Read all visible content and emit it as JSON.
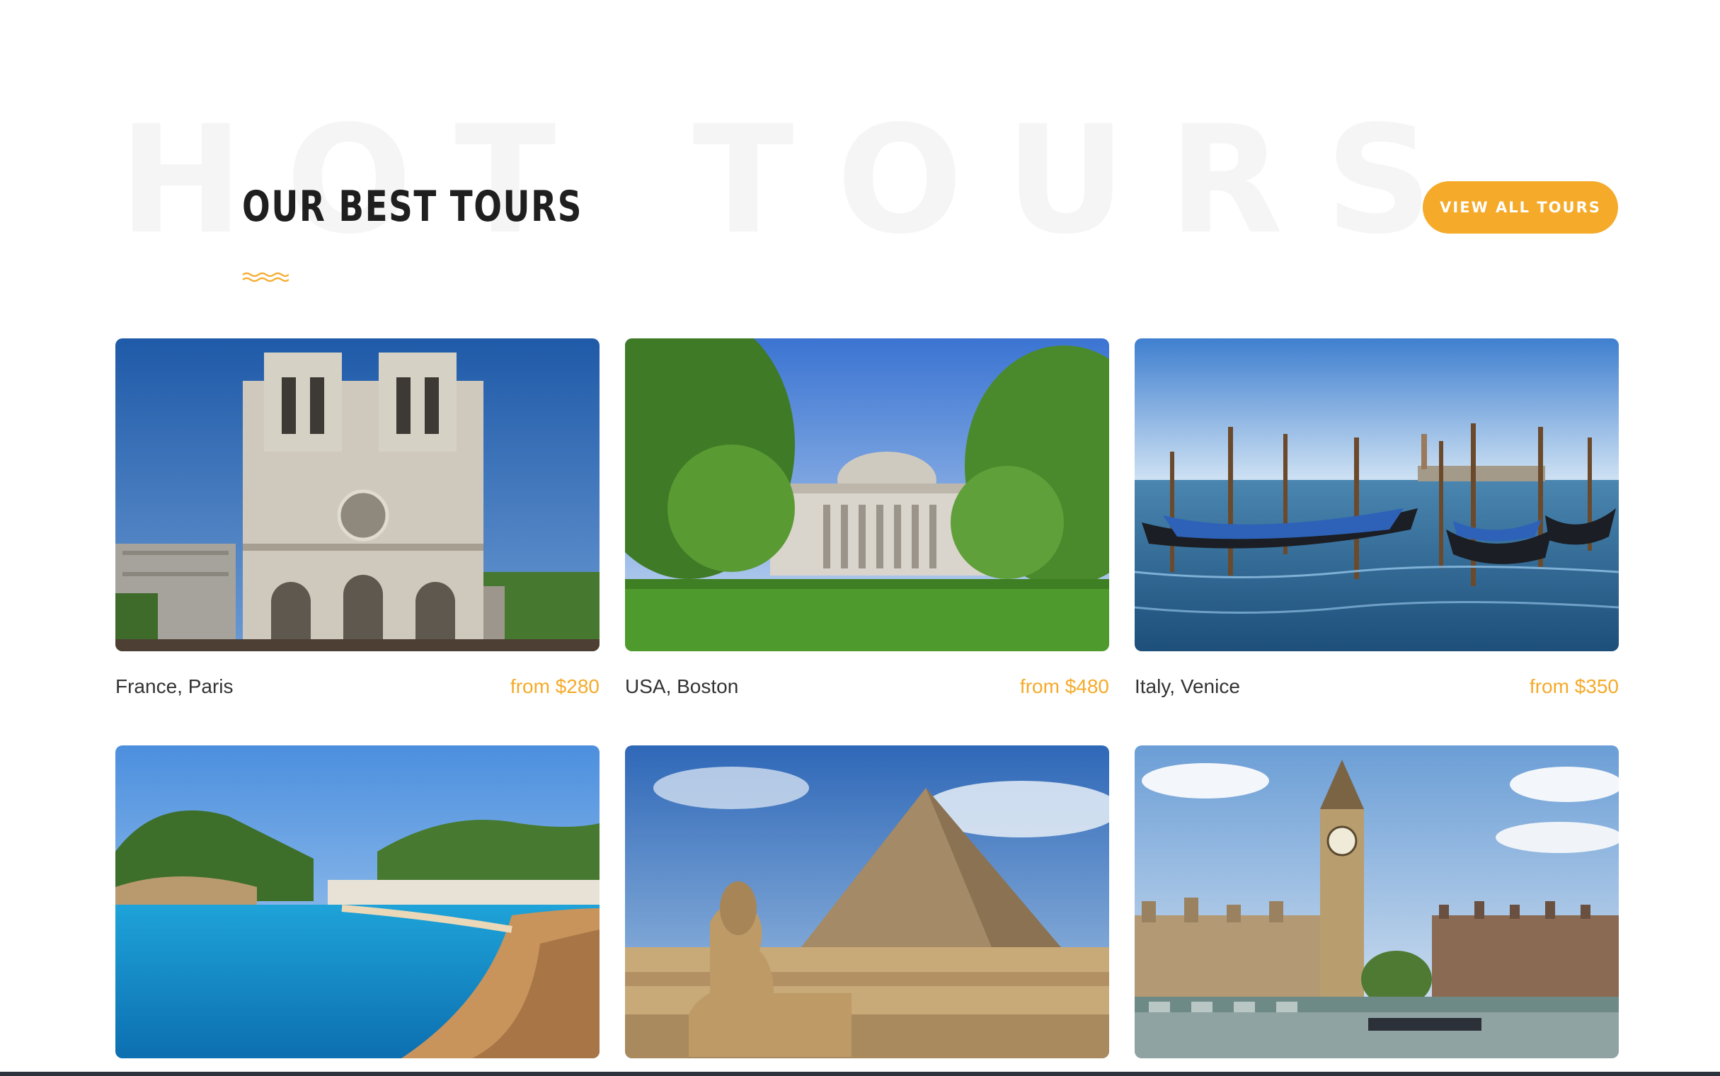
{
  "background_word": "HOT TOURS",
  "section": {
    "title": "OUR BEST TOURS",
    "view_all_label": "VIEW ALL TOURS"
  },
  "colors": {
    "accent": "#f5aa2a",
    "title_text": "#1f1f1f",
    "watermark": "#f5f5f5"
  },
  "tours": [
    {
      "name": "France, Paris",
      "price": "from $280",
      "icon": "notre-dame-image"
    },
    {
      "name": "USA, Boston",
      "price": "from $480",
      "icon": "boston-dome-image"
    },
    {
      "name": "Italy, Venice",
      "price": "from $350",
      "icon": "venice-gondolas-image"
    },
    {
      "name": "",
      "price": "",
      "icon": "coastal-beach-image"
    },
    {
      "name": "",
      "price": "",
      "icon": "pyramid-sphinx-image"
    },
    {
      "name": "",
      "price": "",
      "icon": "big-ben-image"
    }
  ]
}
